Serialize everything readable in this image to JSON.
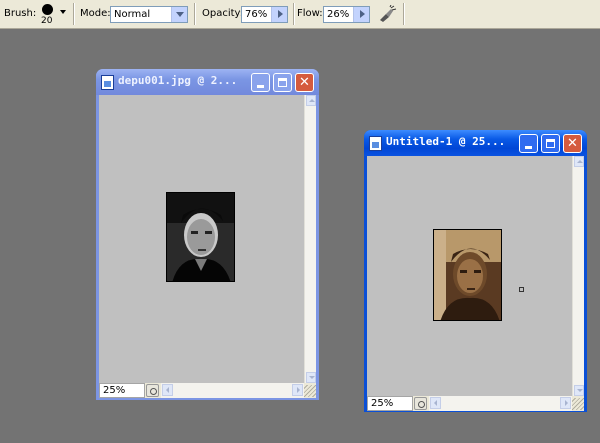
{
  "options_bar": {
    "brush_label": "Brush:",
    "brush_size": "20",
    "mode_label": "Mode:",
    "mode_value": "Normal",
    "opacity_label": "Opacity:",
    "opacity_value": "76%",
    "flow_label": "Flow:",
    "flow_value": "26%",
    "airbrush_icon": "airbrush-icon"
  },
  "windows": [
    {
      "title": "depu001.jpg @ 2...",
      "zoom": "25%",
      "state": "inactive",
      "photo_tone": "black-and-white"
    },
    {
      "title": "Untitled-1 @ 25...",
      "zoom": "25%",
      "state": "active",
      "photo_tone": "sepia"
    }
  ],
  "colors": {
    "workspace": "#737373",
    "canvas_gray": "#c0c0c0",
    "active_title": "#0a5ae6",
    "inactive_title": "#7b96e4",
    "close_button": "#d55b3e"
  }
}
